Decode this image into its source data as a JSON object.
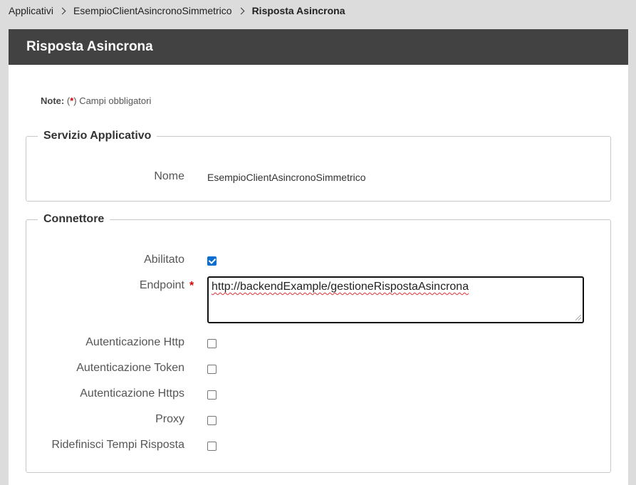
{
  "breadcrumb": {
    "items": [
      "Applicativi",
      "EsempioClientAsincronoSimmetrico"
    ],
    "current": "Risposta Asincrona"
  },
  "panel": {
    "title": "Risposta Asincrona"
  },
  "note": {
    "label": "Note:",
    "open": "(",
    "required_mark": "*",
    "text": ") Campi obbligatori"
  },
  "servizio": {
    "legend": "Servizio Applicativo",
    "nome_label": "Nome",
    "nome_value": "EsempioClientAsincronoSimmetrico"
  },
  "connettore": {
    "legend": "Connettore",
    "abilitato_label": "Abilitato",
    "abilitato_checked": true,
    "endpoint_label": "Endpoint",
    "endpoint_required": "*",
    "endpoint_value": "http://backendExample/gestioneRispostaAsincrona",
    "options": [
      {
        "label": "Autenticazione Http",
        "checked": false
      },
      {
        "label": "Autenticazione Token",
        "checked": false
      },
      {
        "label": "Autenticazione Https",
        "checked": false
      },
      {
        "label": "Proxy",
        "checked": false
      },
      {
        "label": "Ridefinisci Tempi Risposta",
        "checked": false
      }
    ]
  },
  "colors": {
    "header_bg": "#424242",
    "required": "#d40000",
    "page_bg": "#dcdcdc"
  }
}
